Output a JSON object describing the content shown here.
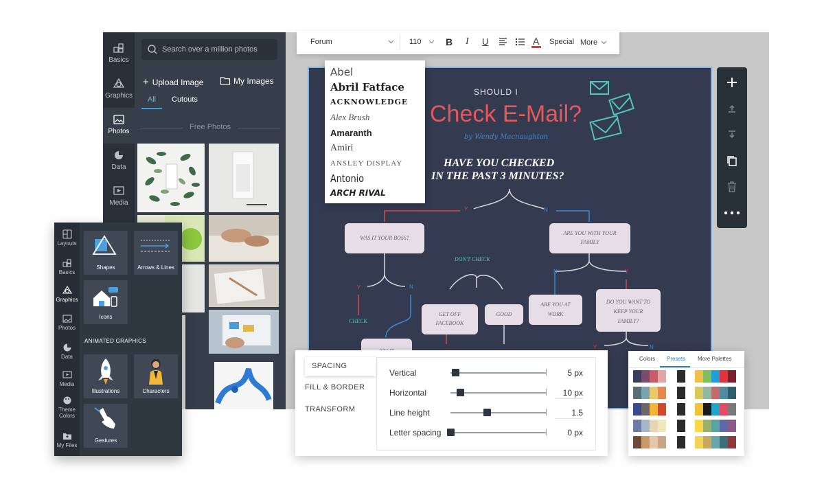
{
  "editor": {
    "rail": [
      "Basics",
      "Graphics",
      "Photos",
      "Data",
      "Media"
    ],
    "search_placeholder": "Search over a million photos",
    "upload_label": "Upload Image",
    "my_images_label": "My Images",
    "tab_all": "All",
    "tab_cutouts": "Cutouts",
    "section_free": "Free Photos"
  },
  "toolbar": {
    "font": "Forum",
    "size": "110",
    "bold": "B",
    "italic": "I",
    "underline": "U",
    "color_glyph": "A",
    "special": "Special",
    "more": "More"
  },
  "font_dropdown": [
    "Abel",
    "Abril Fatface",
    "ACKNOWLEDGE",
    "Alex Brush",
    "Amaranth",
    "Amiri",
    "ANSLEY DISPLAY",
    "Antonio",
    "ARCH RIVAL"
  ],
  "poster": {
    "kicker": "SHOULD I",
    "title": "Check E-Mail?",
    "byline": "by Wendy Macnaughton",
    "question_1": "HAVE YOU CHECKED",
    "question_2": "IN THE PAST 3 MINUTES?",
    "y": "Y",
    "n": "N",
    "boss": "WAS IT YOUR BOSS?",
    "family_1": "ARE YOU WITH YOUR",
    "family_2": "FAMILY",
    "dont_check": "DON'T CHECK",
    "check": "CHECK",
    "facebook_1": "GET OFF",
    "facebook_2": "FACEBOOK",
    "good": "GOOD",
    "work_1": "ARE YOU AT",
    "work_2": "WORK",
    "keep_1": "DO YOU WANT TO",
    "keep_2": "KEEP YOUR",
    "keep_3": "FAMILY?",
    "was_it": "WAS IT"
  },
  "graphics_panel": {
    "rail": [
      "Layouts",
      "Basics",
      "Graphics",
      "Photos",
      "Data",
      "Media",
      "Theme",
      "Colors",
      "My Files"
    ],
    "cards": [
      "Shapes",
      "Arrows & Lines",
      "Icons"
    ],
    "section_animated": "ANIMATED GRAPHICS",
    "animated": [
      "Illustrations",
      "Characters",
      "Gestures"
    ]
  },
  "spacing_panel": {
    "tabs": [
      "SPACING",
      "FILL & BORDER",
      "TRANSFORM"
    ],
    "rows": [
      {
        "label": "Vertical",
        "value": "5 px",
        "level": 0.05
      },
      {
        "label": "Horizontal",
        "value": "10 px",
        "level": 0.1
      },
      {
        "label": "Line height",
        "value": "1.5",
        "level": 0.38
      },
      {
        "label": "Letter spacing",
        "value": "0 px",
        "level": 0.0
      }
    ]
  },
  "colors_panel": {
    "tabs": [
      "Colors",
      "Presets",
      "More Palettes"
    ],
    "palettes": [
      [
        "#3a3e5c",
        "#7a4b6b",
        "#c95c6b",
        "#e3a6a6",
        "#2b2b2b",
        "#f0c04b",
        "#7fbf5b",
        "#1f9fd8",
        "#e0333f",
        "#7a1f2b"
      ],
      [
        "#5a6e7a",
        "#7aa5b0",
        "#e9c96a",
        "#e58a4e",
        "#2b2b2b",
        "#d9c85a",
        "#8fb8a5",
        "#c46a6a",
        "#4f8aa5",
        "#2f5f6a"
      ],
      [
        "#3b4a8a",
        "#6a6a6a",
        "#f2b53b",
        "#d0492b",
        "#2b2b2b",
        "#f3c23c",
        "#1a1a1a",
        "#21a6c9",
        "#e24a66",
        "#7a7a7a"
      ],
      [
        "#6c7ca3",
        "#a7b6cf",
        "#e6d6b4",
        "#f1e7b8",
        "#2b2b2b",
        "#f6d74a",
        "#9ab06d",
        "#5ba3a0",
        "#5d6aa8",
        "#8b5a8b"
      ],
      [
        "#6b4a3a",
        "#c89a6a",
        "#e8c7a8",
        "#c5a788",
        "#2b2b2b",
        "#f0d35a",
        "#c9a85c",
        "#6aa5a8",
        "#3e6d7a",
        "#8a3a3a"
      ]
    ]
  }
}
